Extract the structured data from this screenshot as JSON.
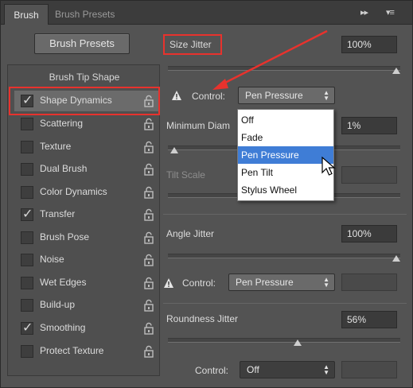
{
  "tabs": {
    "brush": "Brush",
    "brush_presets": "Brush Presets",
    "ctrl_collapse": "▸▸",
    "ctrl_menu": "▾≡"
  },
  "left": {
    "brush_presets_button": "Brush Presets",
    "section_title": "Brush Tip Shape",
    "options": [
      {
        "label": "Shape Dynamics",
        "checked": true,
        "selected": true
      },
      {
        "label": "Scattering",
        "checked": false
      },
      {
        "label": "Texture",
        "checked": false
      },
      {
        "label": "Dual Brush",
        "checked": false
      },
      {
        "label": "Color Dynamics",
        "checked": false
      },
      {
        "label": "Transfer",
        "checked": true
      },
      {
        "label": "Brush Pose",
        "checked": false
      },
      {
        "label": "Noise",
        "checked": false
      },
      {
        "label": "Wet Edges",
        "checked": false
      },
      {
        "label": "Build-up",
        "checked": false
      },
      {
        "label": "Smoothing",
        "checked": true
      },
      {
        "label": "Protect Texture",
        "checked": false
      }
    ],
    "check_glyph": "✓"
  },
  "right": {
    "size_jitter_label": "Size Jitter",
    "size_jitter_value": "100%",
    "size_control_label": "Control:",
    "size_control_value": "Pen Pressure",
    "min_diameter_label": "Minimum Diam",
    "min_diameter_value": "1%",
    "tilt_scale_label": "Tilt Scale",
    "angle_jitter_label": "Angle Jitter",
    "angle_jitter_value": "100%",
    "angle_control_label": "Control:",
    "angle_control_value": "Pen Pressure",
    "roundness_jitter_label": "Roundness Jitter",
    "roundness_jitter_value": "56%",
    "roundness_control_label": "Control:",
    "roundness_control_value": "Off",
    "slider_levels": {
      "size_jitter": 1.0,
      "min_diameter": 0.01,
      "angle_jitter": 1.0,
      "roundness_jitter": 0.56
    }
  },
  "dropdown": {
    "options": [
      "Off",
      "Fade",
      "Pen Pressure",
      "Pen Tilt",
      "Stylus Wheel"
    ],
    "highlighted": "Pen Pressure"
  },
  "colors": {
    "annotation": "#e8322d",
    "highlight": "#3f7dd6"
  }
}
